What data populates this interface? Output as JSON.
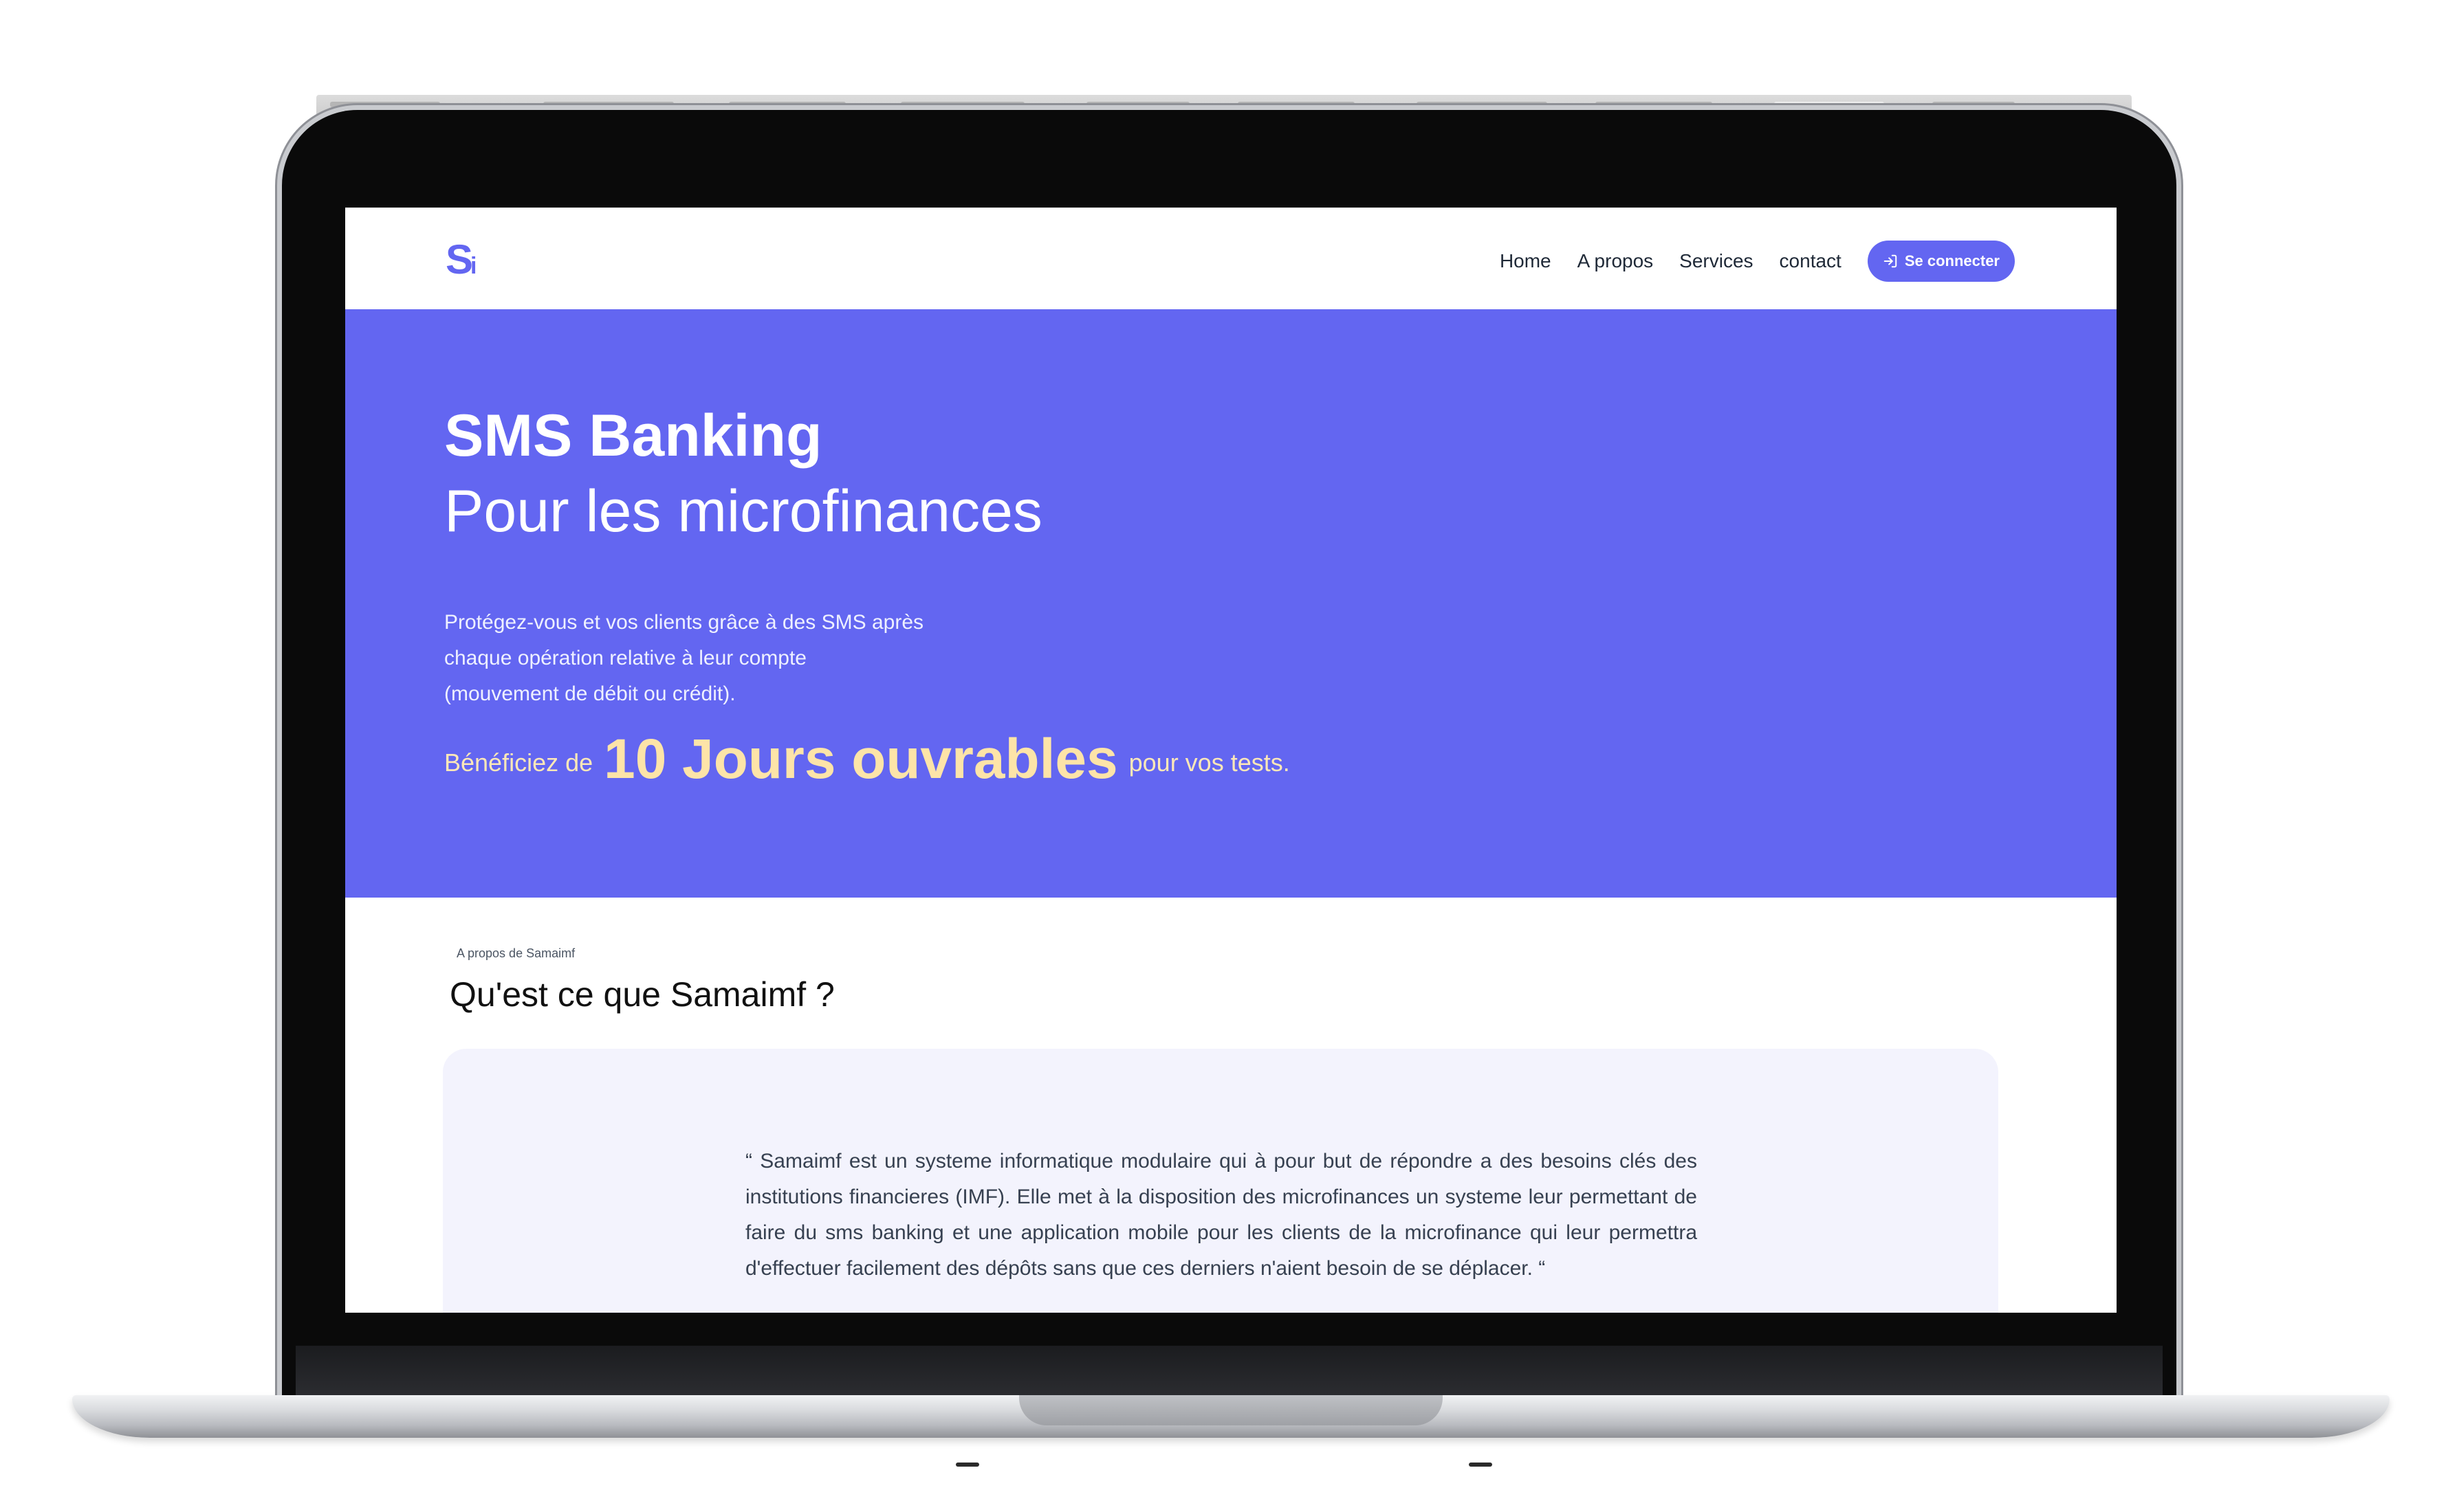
{
  "navbar": {
    "logo_main": "S",
    "logo_small": "i",
    "links": [
      "Home",
      "A propos",
      "Services",
      "contact"
    ],
    "cta_label": "Se connecter"
  },
  "hero": {
    "title": "SMS Banking",
    "subtitle": "Pour les microfinances",
    "description": "Protégez-vous et vos clients grâce à des SMS après chaque opération relative à leur compte (mouvement de débit ou crédit).",
    "offer_prefix": "Bénéficiez de",
    "offer_highlight": "10 Jours ouvrables",
    "offer_suffix": "pour vos tests.",
    "background_color": "#6366f1",
    "highlight_color": "#fde4a8"
  },
  "about": {
    "kicker": "A propos de Samaimf",
    "title": "Qu'est ce que Samaimf ?",
    "quote": "“ Samaimf est un systeme informatique modulaire qui à pour but de répondre a des besoins clés des institutions financieres (IMF). Elle met à la disposition des microfinances un systeme leur permettant de faire du sms banking et une application mobile pour les clients de la microfinance qui leur permettra d'effectuer facilement des dépôts sans que ces derniers n'aient besoin de se déplacer. “"
  },
  "colors": {
    "accent": "#6366f1"
  },
  "icons": {
    "cta_icon": "login-icon"
  }
}
